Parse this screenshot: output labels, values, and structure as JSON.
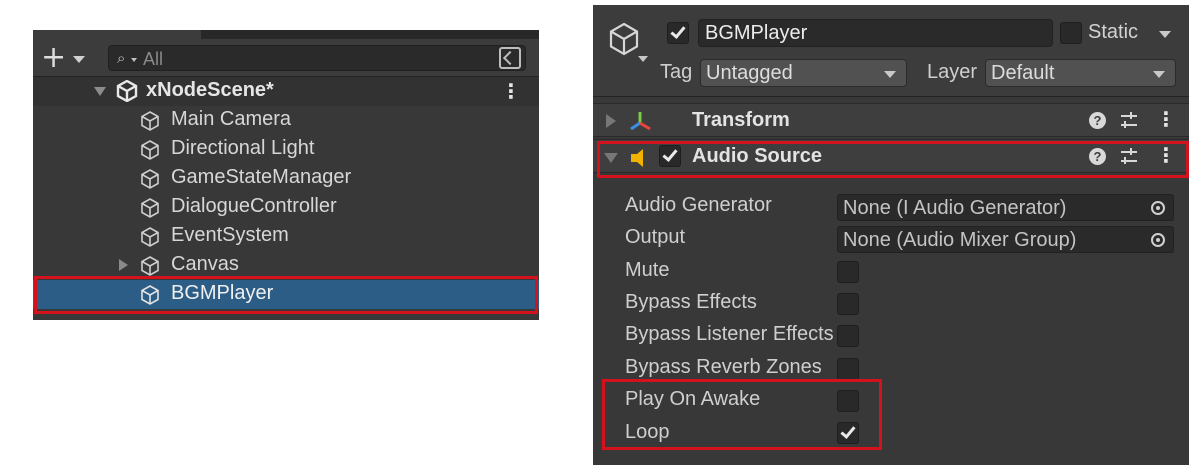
{
  "hierarchy": {
    "search_placeholder": "All",
    "scene_name": "xNodeScene*",
    "objects": [
      {
        "label": "Main Camera"
      },
      {
        "label": "Directional Light"
      },
      {
        "label": "GameStateManager"
      },
      {
        "label": "DialogueController"
      },
      {
        "label": "EventSystem"
      },
      {
        "label": "Canvas"
      },
      {
        "label": "BGMPlayer"
      }
    ],
    "selected": "BGMPlayer"
  },
  "inspector": {
    "object_name": "BGMPlayer",
    "active": true,
    "static_label": "Static",
    "static_checked": false,
    "tag_label": "Tag",
    "tag_value": "Untagged",
    "layer_label": "Layer",
    "layer_value": "Default",
    "components": [
      {
        "name": "Transform",
        "expanded": false
      },
      {
        "name": "Audio Source",
        "expanded": true,
        "enabled": true
      }
    ],
    "audio_source": {
      "audio_generator_label": "Audio Generator",
      "audio_generator_value": "None (I Audio Generator)",
      "output_label": "Output",
      "output_value": "None (Audio Mixer Group)",
      "mute_label": "Mute",
      "mute": false,
      "bypass_effects_label": "Bypass Effects",
      "bypass_effects": false,
      "bypass_listener_effects_label": "Bypass Listener Effects",
      "bypass_listener_effects": false,
      "bypass_reverb_zones_label": "Bypass Reverb Zones",
      "bypass_reverb_zones": false,
      "play_on_awake_label": "Play On Awake",
      "play_on_awake": false,
      "loop_label": "Loop",
      "loop": true
    }
  },
  "colors": {
    "panel": "#383838",
    "selection": "#2c5d87",
    "annotation_red": "#d3121d"
  },
  "icons": {
    "create": "plus-icon",
    "search": "search-icon",
    "lock": "lock-icon",
    "scene": "unity-scene-icon",
    "gameobject": "cube-icon",
    "transform": "transform-axes-icon",
    "audio": "speaker-icon",
    "help": "help-icon",
    "presets": "presets-icon",
    "menu": "kebab-menu-icon",
    "object_picker": "object-picker-icon"
  }
}
